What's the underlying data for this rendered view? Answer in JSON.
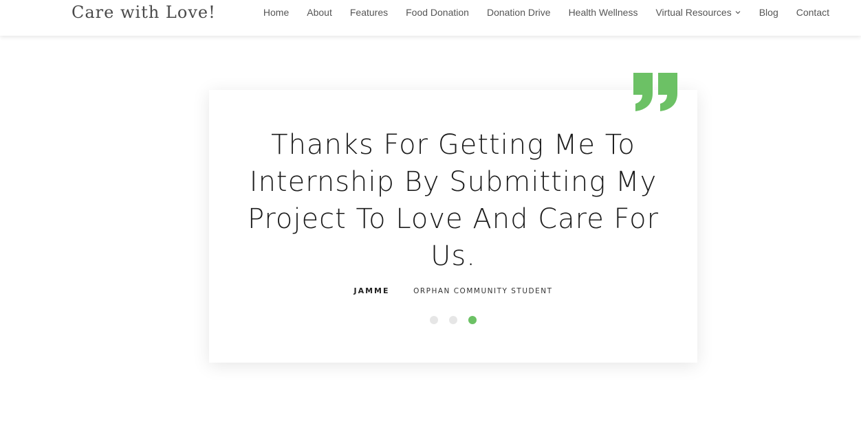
{
  "brand": {
    "title": "Care with Love!"
  },
  "nav": {
    "items": [
      {
        "label": "Home"
      },
      {
        "label": "About"
      },
      {
        "label": "Features"
      },
      {
        "label": "Food Donation"
      },
      {
        "label": "Donation Drive"
      },
      {
        "label": "Health Wellness"
      },
      {
        "label": "Virtual Resources",
        "icon": "chevron-down-icon"
      },
      {
        "label": "Blog"
      },
      {
        "label": "Contact"
      }
    ]
  },
  "testimonial": {
    "quote": "Thanks For Getting Me To Internship By Submitting My Project To Love And Care For Us.",
    "author": "JAMME",
    "role": "ORPHAN COMMUNITY STUDENT",
    "quote_icon": "quote-icon",
    "slides_total": 3,
    "active_slide": 3
  },
  "colors": {
    "accent": "#6cc165",
    "dot_inactive": "#e6e6e6",
    "text": "#1c1c1c"
  }
}
